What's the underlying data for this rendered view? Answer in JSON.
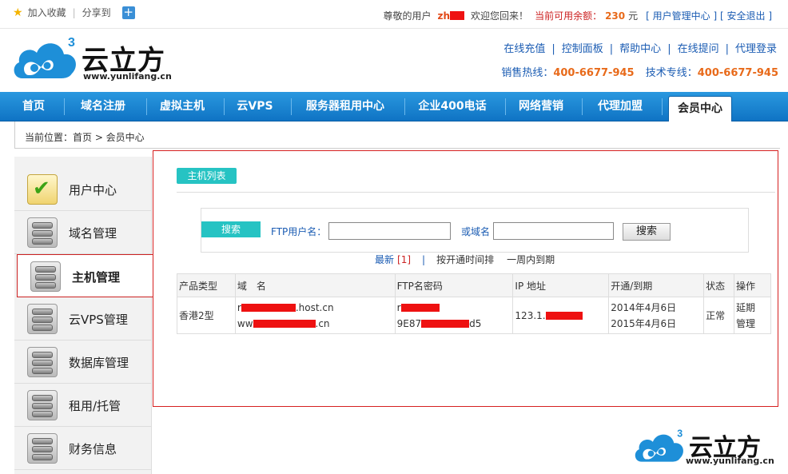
{
  "topbar": {
    "favorite_label": "加入收藏",
    "share_label": "分享到",
    "greeting_prefix": "尊敬的用户",
    "username": "zh",
    "welcome": "欢迎您回来！",
    "balance_label": "当前可用余额：",
    "balance_value": "230",
    "balance_unit": "元",
    "user_center_link": "用户管理中心",
    "logout_link": "安全退出"
  },
  "brand": {
    "name": "云立方",
    "url": "www.yunlifang.cn",
    "badge": "3"
  },
  "quick_links": [
    "在线充值",
    "控制面板",
    "帮助中心",
    "在线提问",
    "代理登录"
  ],
  "hotlines": {
    "sales_label": "销售热线：",
    "sales_number": "400-6677-945",
    "tech_label": "技术专线：",
    "tech_number": "400-6677-945"
  },
  "nav": {
    "items": [
      "首页",
      "域名注册",
      "虚拟主机",
      "云VPS",
      "服务器租用中心",
      "企业400电话",
      "网络营销",
      "代理加盟"
    ],
    "active": "会员中心"
  },
  "breadcrumb": "当前位置：首页 > 会员中心",
  "sidebar": {
    "items": [
      "用户中心",
      "域名管理",
      "主机管理",
      "云VPS管理",
      "数据库管理",
      "租用/托管",
      "财务信息"
    ]
  },
  "main": {
    "tab_label": "主机列表",
    "search": {
      "button": "搜索",
      "ftp_label": "FTP用户名：",
      "domain_label": "或域名",
      "submit": "搜索"
    },
    "filters": {
      "latest": "最新",
      "latest_count": "[1]",
      "by_open_time": "按开通时间排",
      "expiring_week": "一周内到期"
    },
    "table": {
      "headers": [
        "产品类型",
        "域　名",
        "FTP名密码",
        "IP 地址",
        "开通/到期",
        "状态",
        "操作"
      ],
      "rows": [
        {
          "type": "香港2型",
          "domain1_prefix": "r",
          "domain1_suffix": ".host.cn",
          "domain2_prefix": "ww",
          "domain2_suffix": ".cn",
          "ftp_user_prefix": "r",
          "ftp_pass_prefix": "9E87",
          "ftp_pass_suffix": "d5",
          "ip_prefix": "123.1.",
          "open_date": "2014年4月6日",
          "expire_date": "2015年4月6日",
          "status": "正常",
          "action_renew": "延期",
          "action_manage": "管理"
        }
      ]
    }
  },
  "colors": {
    "nav_blue": "#1a86d4",
    "accent_teal": "#26c3c3",
    "price_orange": "#e86a1a",
    "link_blue": "#1b5cb3",
    "highlight_red": "#d62020"
  }
}
